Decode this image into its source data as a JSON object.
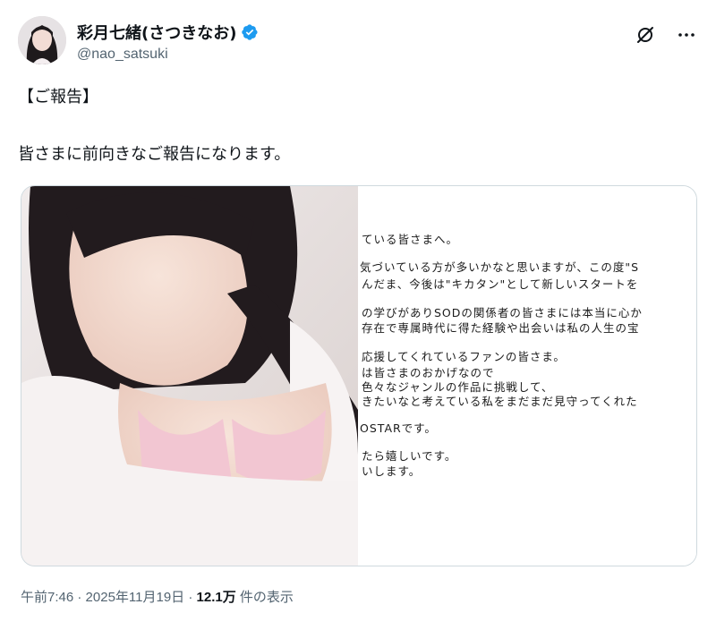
{
  "author": {
    "display_name": "彩月七緒(さつきなお)",
    "handle": "@nao_satsuki",
    "verified": true
  },
  "tweet": {
    "line1": "【ご報告】",
    "line2": "皆さまに前向きなご報告になります。"
  },
  "media": {
    "letter_lines": [
      "ている皆さまへ。",
      "気づいている方が多いかなと思いますが、この度\"S",
      "んだま、今後は\"キカタン\"として新しいスタートを",
      "の学びがありSODの関係者の皆さまには本当に心か",
      "存在で専属時代に得た経験や出会いは私の人生の宝",
      "応援してくれているファンの皆さま。",
      "は皆さまのおかげなので",
      "色々なジャンルの作品に挑戦して、",
      "きたいなと考えている私をまだまだ見守ってくれた",
      "OSTARです。",
      "たら嬉しいです。",
      "いします。"
    ]
  },
  "meta": {
    "time": "午前7:46",
    "date": "2025年11月19日",
    "separator": "·",
    "views": "12.1万",
    "views_label": "件の表示"
  },
  "icons": {
    "verified": "verified-badge-icon",
    "grok": "grok-icon",
    "more": "more-options-icon"
  },
  "colors": {
    "verified_blue": "#1d9bf0",
    "secondary_text": "#536471",
    "primary_text": "#0f1419"
  }
}
